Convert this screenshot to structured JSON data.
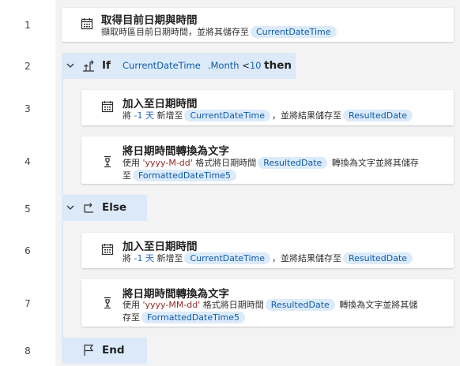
{
  "line_numbers": [
    "1",
    "2",
    "3",
    "4",
    "5",
    "6",
    "7",
    "8"
  ],
  "step1": {
    "title": "取得目前日期與時間",
    "desc_pre": "擷取時區目前日期時間，並將其儲存至",
    "var": "CurrentDateTime"
  },
  "if_block": {
    "keyword": "If",
    "var": "CurrentDateTime",
    "prop": ".Month",
    "op": "<",
    "value": "10",
    "then": "then"
  },
  "step3": {
    "title": "加入至日期時間",
    "w1": "將",
    "amount": "-1 天",
    "w2": "新增至",
    "var1": "CurrentDateTime",
    "w3": "，並將結果儲存至",
    "var2": "ResultedDate"
  },
  "step4": {
    "title": "將日期時間轉換為文字",
    "w1": "使用",
    "format": "'yyyy-M-dd'",
    "w2": "格式將日期時間",
    "var1": "ResultedDate",
    "w3": "轉換為文字並將其儲存",
    "w4": "至",
    "var2": "FormattedDateTime5"
  },
  "else_block": {
    "keyword": "Else"
  },
  "step6": {
    "title": "加入至日期時間",
    "w1": "將",
    "amount": "-1 天",
    "w2": "新增至",
    "var1": "CurrentDateTime",
    "w3": "，並將結果儲存至",
    "var2": "ResultedDate"
  },
  "step7": {
    "title": "將日期時間轉換為文字",
    "w1": "使用",
    "format": "'yyyy-MM-dd'",
    "w2": "格式將日期時間",
    "var1": "ResultedDate",
    "w3": "轉換為文字並將其儲",
    "w4": "存至",
    "var2": "FormattedDateTime5"
  },
  "end_block": {
    "keyword": "End"
  },
  "colors": {
    "header_bg": "#dbe9f8",
    "token_bg": "#dcebfa",
    "token_text": "#0f5aa7",
    "string_text": "#8f2a2a"
  },
  "icons": {
    "step1": "calendar-icon",
    "if": "branch-icon",
    "step3": "calendar-icon",
    "step4": "convert-icon",
    "else": "else-branch-icon",
    "step6": "calendar-icon",
    "step7": "convert-icon",
    "end": "flag-icon"
  }
}
